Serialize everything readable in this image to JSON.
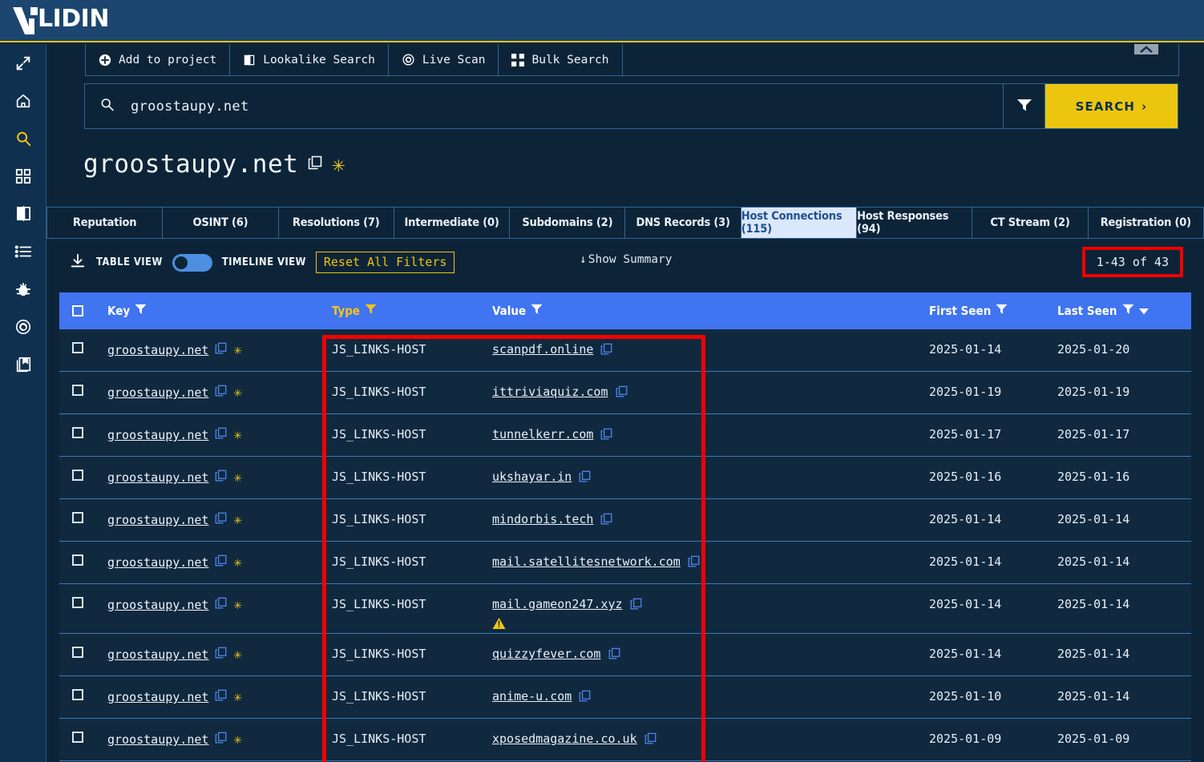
{
  "brand": {
    "name": "VALIDIN"
  },
  "sidebar": {
    "items": [
      {
        "name": "expand-icon",
        "label": "Expand"
      },
      {
        "name": "home-icon",
        "label": "Home"
      },
      {
        "name": "search-icon",
        "label": "Search"
      },
      {
        "name": "dashboard-icon",
        "label": "Dashboard"
      },
      {
        "name": "lookalike-icon",
        "label": "Lookalike"
      },
      {
        "name": "list-icon",
        "label": "Lists"
      },
      {
        "name": "bug-icon",
        "label": "Threats"
      },
      {
        "name": "target-icon",
        "label": "Live Scan"
      },
      {
        "name": "library-icon",
        "label": "Collections"
      }
    ]
  },
  "toolbar": {
    "add_to_project": "Add to project",
    "lookalike_search": "Lookalike Search",
    "live_scan": "Live Scan",
    "bulk_search": "Bulk Search"
  },
  "search": {
    "value": "groostaupy.net",
    "placeholder": "groostaupy.net",
    "button_label": "SEARCH",
    "button_chevron": "›"
  },
  "page": {
    "title": "groostaupy.net",
    "star": "✳"
  },
  "tabs": [
    {
      "label": "Reputation",
      "active": false
    },
    {
      "label": "OSINT (6)",
      "active": false
    },
    {
      "label": "Resolutions (7)",
      "active": false
    },
    {
      "label": "Intermediate (0)",
      "active": false
    },
    {
      "label": "Subdomains (2)",
      "active": false
    },
    {
      "label": "DNS Records (3)",
      "active": false
    },
    {
      "label": "Host Connections (115)",
      "active": true
    },
    {
      "label": "Host Responses (94)",
      "active": false
    },
    {
      "label": "CT Stream (2)",
      "active": false
    },
    {
      "label": "Registration (0)",
      "active": false
    }
  ],
  "controls": {
    "table_view": "TABLE VIEW",
    "timeline_view": "TIMELINE VIEW",
    "reset_filters": "Reset All Filters",
    "show_summary": "Show Summary",
    "show_summary_arrow": "↓",
    "record_count": "1-43 of 43",
    "toggle_on": false
  },
  "table": {
    "headers": {
      "key": "Key",
      "type": "Type",
      "value": "Value",
      "first_seen": "First Seen",
      "last_seen": "Last Seen"
    },
    "rows": [
      {
        "key": "groostaupy.net",
        "type": "JS_LINKS-HOST",
        "value": "scanpdf.online",
        "first_seen": "2025-01-14",
        "last_seen": "2025-01-20",
        "warning": false
      },
      {
        "key": "groostaupy.net",
        "type": "JS_LINKS-HOST",
        "value": "ittriviaquiz.com",
        "first_seen": "2025-01-19",
        "last_seen": "2025-01-19",
        "warning": false
      },
      {
        "key": "groostaupy.net",
        "type": "JS_LINKS-HOST",
        "value": "tunnelkerr.com",
        "first_seen": "2025-01-17",
        "last_seen": "2025-01-17",
        "warning": false
      },
      {
        "key": "groostaupy.net",
        "type": "JS_LINKS-HOST",
        "value": "ukshayar.in",
        "first_seen": "2025-01-16",
        "last_seen": "2025-01-16",
        "warning": false
      },
      {
        "key": "groostaupy.net",
        "type": "JS_LINKS-HOST",
        "value": "mindorbis.tech",
        "first_seen": "2025-01-14",
        "last_seen": "2025-01-14",
        "warning": false
      },
      {
        "key": "groostaupy.net",
        "type": "JS_LINKS-HOST",
        "value": "mail.satellitesnetwork.com",
        "first_seen": "2025-01-14",
        "last_seen": "2025-01-14",
        "warning": false
      },
      {
        "key": "groostaupy.net",
        "type": "JS_LINKS-HOST",
        "value": "mail.gameon247.xyz",
        "first_seen": "2025-01-14",
        "last_seen": "2025-01-14",
        "warning": true
      },
      {
        "key": "groostaupy.net",
        "type": "JS_LINKS-HOST",
        "value": "quizzyfever.com",
        "first_seen": "2025-01-14",
        "last_seen": "2025-01-14",
        "warning": false
      },
      {
        "key": "groostaupy.net",
        "type": "JS_LINKS-HOST",
        "value": "anime-u.com",
        "first_seen": "2025-01-10",
        "last_seen": "2025-01-14",
        "warning": false
      },
      {
        "key": "groostaupy.net",
        "type": "JS_LINKS-HOST",
        "value": "xposedmagazine.co.uk",
        "first_seen": "2025-01-09",
        "last_seen": "2025-01-09",
        "warning": false
      }
    ]
  },
  "colors": {
    "brand_navy": "#1c4670",
    "page_bg": "#0d2438",
    "accent_yellow": "#ecc60e",
    "header_blue": "#4074f0",
    "link_blue": "#4d82e8",
    "annotation_red": "#f40000",
    "active_tab_bg": "#dbe7fb"
  }
}
